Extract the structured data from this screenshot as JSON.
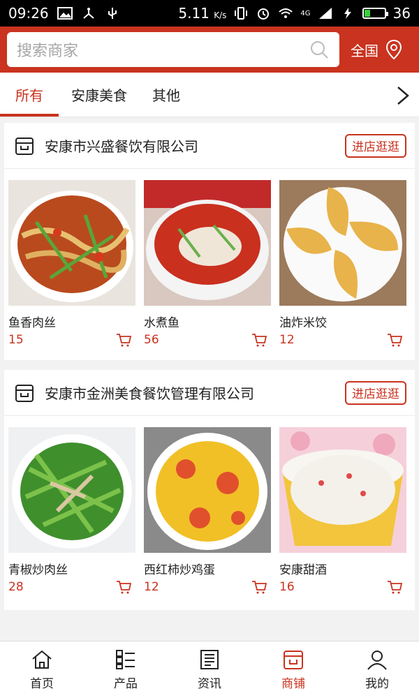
{
  "status_bar": {
    "time": "09:26",
    "speed": "5.11",
    "speed_unit": "K/s",
    "network": "4G",
    "battery": "36",
    "battery_fraction": 0.36,
    "left_icons": [
      "image-icon",
      "usb-share-icon",
      "usb-icon"
    ],
    "right_icons": [
      "vibrate-icon",
      "alarm-icon",
      "wifi-icon",
      "signal-icon",
      "charging-icon"
    ]
  },
  "header": {
    "search_placeholder": "搜索商家",
    "region_label": "全国",
    "colors": {
      "brand": "#c9331f"
    }
  },
  "tabs": {
    "items": [
      {
        "label": "所有",
        "active": true
      },
      {
        "label": "安康美食",
        "active": false
      },
      {
        "label": "其他",
        "active": false
      }
    ]
  },
  "shops": [
    {
      "name": "安康市兴盛餐饮有限公司",
      "enter_label": "进店逛逛",
      "products": [
        {
          "name": "鱼香肉丝",
          "price": "15"
        },
        {
          "name": "水煮鱼",
          "price": "56"
        },
        {
          "name": "油炸米饺",
          "price": "12"
        }
      ]
    },
    {
      "name": "安康市金洲美食餐饮管理有限公司",
      "enter_label": "进店逛逛",
      "products": [
        {
          "name": "青椒炒肉丝",
          "price": "28"
        },
        {
          "name": "西红柿炒鸡蛋",
          "price": "12"
        },
        {
          "name": "安康甜酒",
          "price": "16"
        }
      ]
    }
  ],
  "bottom_nav": {
    "items": [
      {
        "label": "首页",
        "icon": "home-icon",
        "active": false
      },
      {
        "label": "产品",
        "icon": "product-list-icon",
        "active": false
      },
      {
        "label": "资讯",
        "icon": "news-icon",
        "active": false
      },
      {
        "label": "商铺",
        "icon": "shop-icon",
        "active": true
      },
      {
        "label": "我的",
        "icon": "user-icon",
        "active": false
      }
    ]
  }
}
